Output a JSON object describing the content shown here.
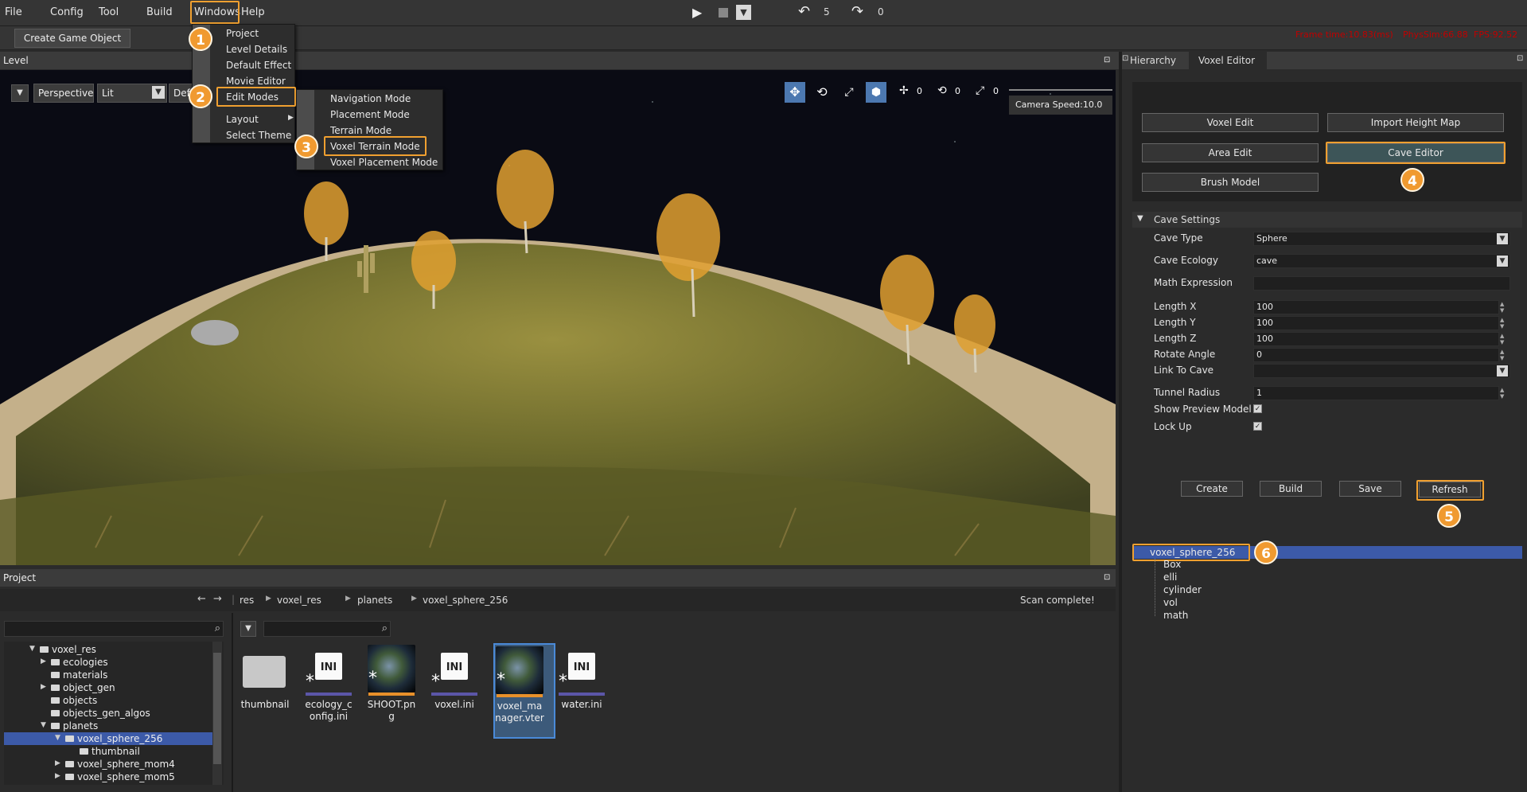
{
  "menubar": {
    "items": [
      "File",
      "Config",
      "Tool",
      "Build",
      "Windows",
      "Help"
    ],
    "undo_count": "5",
    "redo_count": "0",
    "stats": {
      "frame_time": "Frame time:10.83(ms)",
      "phys_sim": "PhysSim:66.88",
      "fps": "FPS:92.52"
    }
  },
  "toolbar": {
    "create_game_object": "Create Game Object"
  },
  "windows_menu": {
    "items": [
      "Project",
      "Level Details",
      "Default Effect",
      "Movie Editor",
      "Edit Modes",
      "Layout",
      "Select Theme"
    ]
  },
  "edit_modes_submenu": {
    "items": [
      "Navigation Mode",
      "Placement Mode",
      "Terrain Mode",
      "Voxel Terrain Mode",
      "Voxel Placement Mode"
    ]
  },
  "level_panel": {
    "title": "Level",
    "perspective": "Perspective",
    "lit": "Lit",
    "default_partial": "Def",
    "counters": [
      "0",
      "0",
      "0"
    ],
    "camera_speed": "Camera Speed:10.0"
  },
  "right_panel": {
    "tabs": [
      "Hierarchy",
      "Voxel Editor"
    ],
    "buttons": [
      "Voxel Edit",
      "Import Height Map",
      "Area Edit",
      "Cave Editor",
      "Brush Model"
    ],
    "cave_settings": {
      "header": "Cave Settings",
      "cave_type_label": "Cave Type",
      "cave_type": "Sphere",
      "cave_ecology_label": "Cave Ecology",
      "cave_ecology": "cave",
      "math_expression_label": "Math Expression",
      "math_expression": "",
      "length_x_label": "Length X",
      "length_x": "100",
      "length_y_label": "Length Y",
      "length_y": "100",
      "length_z_label": "Length Z",
      "length_z": "100",
      "rotate_angle_label": "Rotate Angle",
      "rotate_angle": "0",
      "link_to_cave_label": "Link To Cave",
      "link_to_cave": "",
      "tunnel_radius_label": "Tunnel Radius",
      "tunnel_radius": "1",
      "show_preview_label": "Show Preview Model",
      "show_preview": true,
      "lock_up_label": "Lock Up",
      "lock_up": true
    },
    "action_buttons": [
      "Create",
      "Build",
      "Save",
      "Refresh"
    ],
    "tree": {
      "root": "voxel_sphere_256",
      "children": [
        "Box",
        "elli",
        "cylinder",
        "vol",
        "math"
      ]
    }
  },
  "project_panel": {
    "title": "Project",
    "breadcrumb": [
      "res",
      "voxel_res",
      "planets",
      "voxel_sphere_256"
    ],
    "status": "Scan complete!",
    "tree": [
      {
        "label": "voxel_res",
        "depth": 0,
        "expanded": true
      },
      {
        "label": "ecologies",
        "depth": 1,
        "expanded": false
      },
      {
        "label": "materials",
        "depth": 1,
        "expanded": null
      },
      {
        "label": "object_gen",
        "depth": 1,
        "expanded": false
      },
      {
        "label": "objects",
        "depth": 1,
        "expanded": null
      },
      {
        "label": "objects_gen_algos",
        "depth": 1,
        "expanded": null
      },
      {
        "label": "planets",
        "depth": 1,
        "expanded": true
      },
      {
        "label": "voxel_sphere_256",
        "depth": 2,
        "expanded": true,
        "selected": true
      },
      {
        "label": "thumbnail",
        "depth": 3,
        "expanded": null
      },
      {
        "label": "voxel_sphere_mom4",
        "depth": 2,
        "expanded": false
      },
      {
        "label": "voxel_sphere_mom5",
        "depth": 2,
        "expanded": false
      }
    ],
    "files": [
      {
        "name": "thumbnail",
        "type": "folder"
      },
      {
        "name": "ecology_config.ini",
        "type": "ini",
        "line1": "ecology_c",
        "line2": "onfig.ini",
        "bar": "#5b56a8"
      },
      {
        "name": "SHOOT.png",
        "type": "image",
        "line1": "SHOOT.pn",
        "line2": "g",
        "bar": "#e8902a"
      },
      {
        "name": "voxel.ini",
        "type": "ini",
        "line1": "voxel.ini",
        "line2": "",
        "bar": "#5b56a8"
      },
      {
        "name": "voxel_manager.vter",
        "type": "image",
        "line1": "voxel_ma",
        "line2": "nager.vter",
        "bar": "#e8902a",
        "selected": true
      },
      {
        "name": "water.ini",
        "type": "ini",
        "line1": "water.ini",
        "line2": "",
        "bar": "#5b56a8"
      }
    ]
  },
  "step_badges": [
    "1",
    "2",
    "3",
    "4",
    "5",
    "6"
  ],
  "colors": {
    "accent": "#f0a030",
    "selection": "#3c5aa8",
    "panel": "#2b2b2b"
  }
}
